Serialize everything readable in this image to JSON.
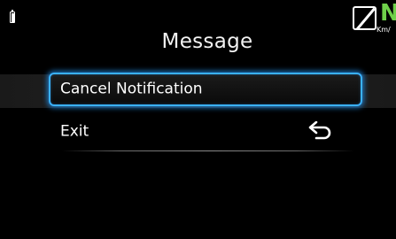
{
  "status": {
    "battery_icon": "battery-icon",
    "gear_letter": "N",
    "speed_unit": "Km/",
    "speed_icon": "speed-limit-off-icon",
    "gear_color": "#6fd04a"
  },
  "dialog": {
    "title": "Message",
    "items": [
      {
        "label": "Cancel Notification",
        "selected": true
      },
      {
        "label": "Exit",
        "icon": "back-arrow-icon",
        "selected": false
      }
    ]
  },
  "colors": {
    "background": "#000000",
    "selection_border": "#3ab1ff",
    "text": "#ffffff"
  }
}
